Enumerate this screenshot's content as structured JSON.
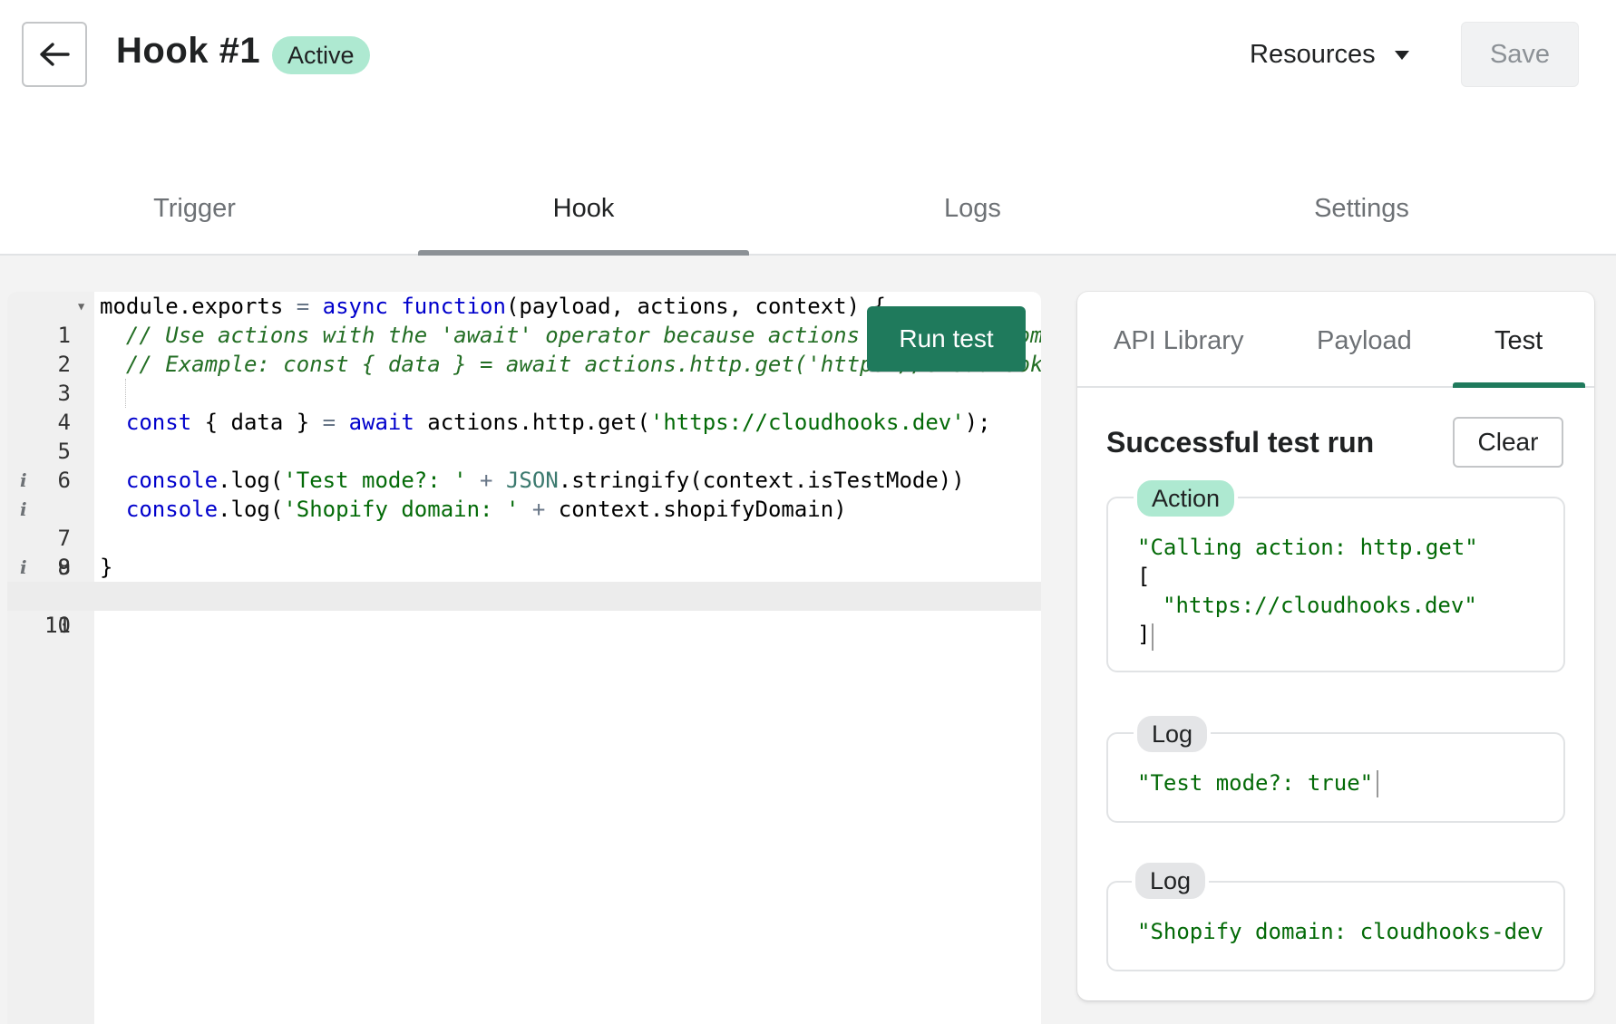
{
  "header": {
    "back_icon": "arrow-left-icon",
    "title": "Hook #1",
    "status": "Active",
    "resources_label": "Resources",
    "save_label": "Save"
  },
  "tabs": [
    {
      "label": "Trigger",
      "active": false
    },
    {
      "label": "Hook",
      "active": true
    },
    {
      "label": "Logs",
      "active": false
    },
    {
      "label": "Settings",
      "active": false
    }
  ],
  "editor": {
    "line_numbers": [
      "1",
      "2",
      "3",
      "4",
      "5",
      "6",
      "7",
      "8",
      "9",
      "10",
      "11"
    ],
    "code": {
      "l1a": "module.exports ",
      "l1b": "= ",
      "l1c": "async",
      "l1d": " ",
      "l1e": "function",
      "l1f": "(payload, actions, context) {",
      "l2": "  // Use actions with the 'await' operator because actions return a prom",
      "l3": "  // Example: const { data } = await actions.http.get('https://cloudhook",
      "l5a": "  ",
      "l5b": "const",
      "l5c": " { data } ",
      "l5d": "=",
      "l5e": " ",
      "l5f": "await",
      "l5g": " actions.http.get(",
      "l5h": "'https://cloudhooks.dev'",
      "l5i": ");",
      "l7a": "  ",
      "l7b": "console",
      "l7c": ".log(",
      "l7d": "'Test mode?: '",
      "l7e": " + ",
      "l7f": "JSON",
      "l7g": ".stringify(context.isTestMode))",
      "l8a": "  ",
      "l8b": "console",
      "l8c": ".log(",
      "l8d": "'Shopify domain: '",
      "l8e": " + ",
      "l8f": "context.shopifyDomain)",
      "l10": "}"
    },
    "run_test_label": "Run test"
  },
  "panel": {
    "tabs": [
      {
        "label": "API Library",
        "active": false
      },
      {
        "label": "Payload",
        "active": false
      },
      {
        "label": "Test",
        "active": true
      }
    ],
    "result_title": "Successful test run",
    "clear_label": "Clear",
    "entries": [
      {
        "badge": "Action",
        "line1": "\"Calling action: http.get\"",
        "open_bracket": "[",
        "line2": "\"https://cloudhooks.dev\"",
        "close_bracket": "]"
      },
      {
        "badge": "Log",
        "line1": "\"Test mode?: true\""
      },
      {
        "badge": "Log",
        "line1": "\"Shopify domain: cloudhooks-dev"
      }
    ]
  },
  "colors": {
    "accent_green": "#1f7a5c",
    "badge_green": "#aee9d1",
    "string_green": "#036a07",
    "keyword_blue": "#0000cc"
  }
}
